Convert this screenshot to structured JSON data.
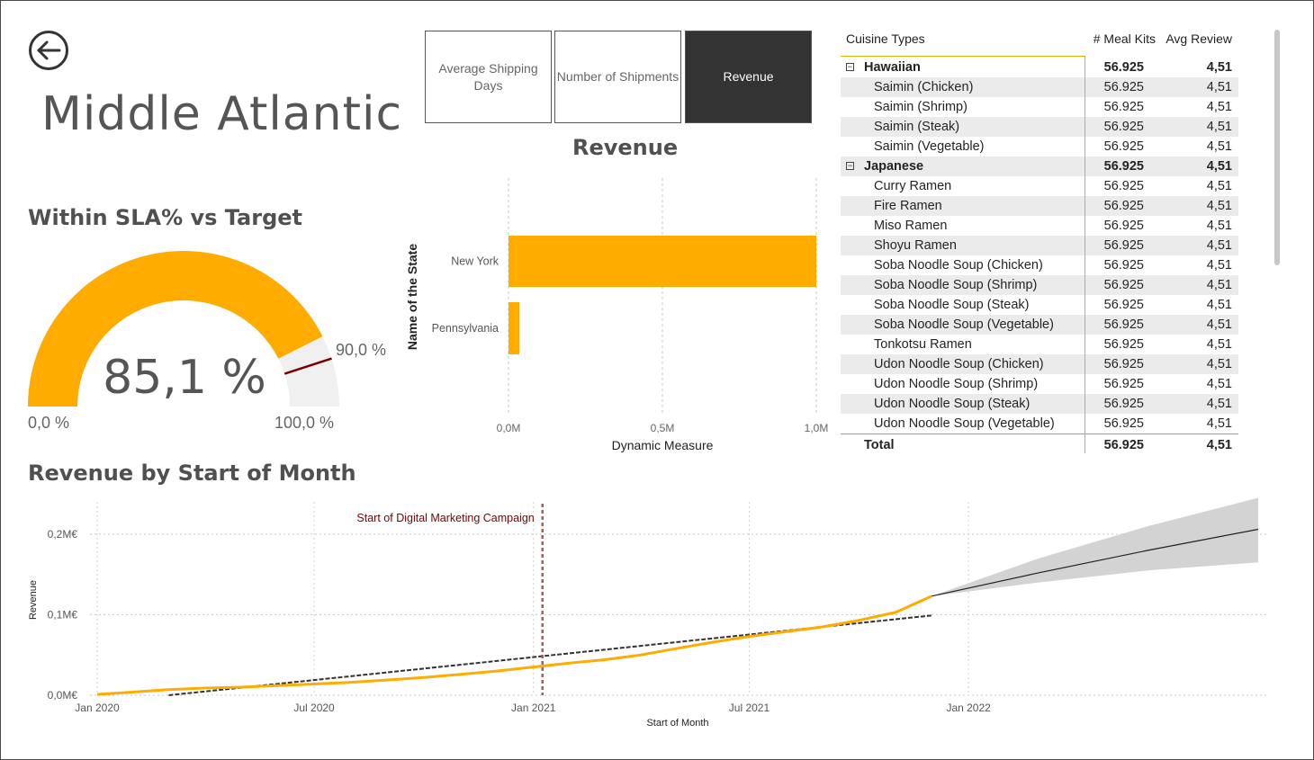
{
  "page": {
    "title": "Middle Atlantic"
  },
  "buttons": [
    {
      "label": "Average Shipping Days",
      "active": false
    },
    {
      "label": "Number of Shipments",
      "active": false
    },
    {
      "label": "Revenue",
      "active": true
    }
  ],
  "gauge": {
    "title": "Within SLA% vs Target",
    "value_label": "85,1 %",
    "min_label": "0,0 %",
    "max_label": "100,0 %",
    "target_label": "90,0 %",
    "value": 85.1,
    "target": 90.0,
    "min": 0,
    "max": 100,
    "fill_color": "#FFAB00",
    "track_color": "#F0F0F0",
    "target_color": "#7A0000"
  },
  "bar_chart": {
    "title": "Revenue",
    "ylabel": "Name of the State",
    "xlabel": "Dynamic Measure",
    "ticks": [
      "0,0M",
      "0,5M",
      "1,0M"
    ]
  },
  "line_chart": {
    "title": "Revenue by Start of Month",
    "ylabel": "Revenue",
    "xlabel": "Start of Month",
    "y_ticks": [
      "0,0M€",
      "0,1M€",
      "0,2M€"
    ],
    "x_ticks": [
      "Jan 2020",
      "Jul 2020",
      "Jan 2021",
      "Jul 2021",
      "Jan 2022"
    ],
    "annotation": "Start of Digital Marketing Campaign"
  },
  "chart_data": [
    {
      "type": "gauge",
      "value": 85.1,
      "target": 90.0,
      "min": 0,
      "max": 100
    },
    {
      "type": "bar",
      "orientation": "horizontal",
      "title": "Revenue",
      "categories": [
        "New York",
        "Pennsylvania"
      ],
      "values": [
        1.0,
        0.035
      ],
      "unit": "M",
      "xlabel": "Dynamic Measure",
      "ylabel": "Name of the State",
      "xlim": [
        0,
        1.0
      ],
      "color": "#FFAB00"
    },
    {
      "type": "line",
      "title": "Revenue by Start of Month",
      "xlabel": "Start of Month",
      "ylabel": "Revenue",
      "ylim": [
        0,
        0.24
      ],
      "unit": "M€",
      "x_range": [
        "2020-01-01",
        "2022-09-01"
      ],
      "series": [
        {
          "color": "#FFAB00",
          "x": [
            "2020-01-01",
            "2020-02-01",
            "2020-03-01",
            "2020-04-01",
            "2020-05-01",
            "2020-06-01",
            "2020-07-01",
            "2020-08-01",
            "2020-09-01",
            "2020-10-01",
            "2020-11-01",
            "2020-12-01",
            "2021-01-01",
            "2021-02-01",
            "2021-03-01",
            "2021-04-01",
            "2021-05-01",
            "2021-06-01",
            "2021-07-01",
            "2021-08-01",
            "2021-09-01",
            "2021-10-01",
            "2021-11-01",
            "2021-12-01"
          ],
          "values": [
            0.001,
            0.004,
            0.007,
            0.009,
            0.01,
            0.012,
            0.014,
            0.016,
            0.019,
            0.022,
            0.026,
            0.03,
            0.035,
            0.04,
            0.044,
            0.05,
            0.058,
            0.066,
            0.073,
            0.079,
            0.085,
            0.093,
            0.103,
            0.123
          ]
        },
        {
          "style": "dashed",
          "color": "#333333",
          "x": [
            "2020-03-01",
            "2021-12-01"
          ],
          "values": [
            0.0,
            0.099
          ]
        },
        {
          "style": "forecast",
          "color": "#222222",
          "band_color": "#D3D3D3",
          "x": [
            "2021-12-01",
            "2022-03-01",
            "2022-06-01",
            "2022-09-01"
          ],
          "values": [
            0.123,
            0.152,
            0.18,
            0.206
          ],
          "upper": [
            0.123,
            0.17,
            0.21,
            0.245
          ],
          "lower": [
            0.123,
            0.14,
            0.155,
            0.165
          ]
        }
      ],
      "annotations": [
        {
          "x": "2021-01-01",
          "label": "Start of Digital Marketing Campaign",
          "color": "#7A0000",
          "style": "dashed"
        }
      ]
    }
  ],
  "table": {
    "columns": [
      "Cuisine Types",
      "# Meal Kits",
      "Avg Review"
    ],
    "groups": [
      {
        "name": "Hawaiian",
        "meal_kits": "56.925",
        "avg_review": "4,51",
        "items": [
          {
            "name": "Saimin (Chicken)",
            "meal_kits": "56.925",
            "avg_review": "4,51"
          },
          {
            "name": "Saimin (Shrimp)",
            "meal_kits": "56.925",
            "avg_review": "4,51"
          },
          {
            "name": "Saimin (Steak)",
            "meal_kits": "56.925",
            "avg_review": "4,51"
          },
          {
            "name": "Saimin (Vegetable)",
            "meal_kits": "56.925",
            "avg_review": "4,51"
          }
        ]
      },
      {
        "name": "Japanese",
        "meal_kits": "56.925",
        "avg_review": "4,51",
        "items": [
          {
            "name": "Curry Ramen",
            "meal_kits": "56.925",
            "avg_review": "4,51"
          },
          {
            "name": "Fire Ramen",
            "meal_kits": "56.925",
            "avg_review": "4,51"
          },
          {
            "name": "Miso Ramen",
            "meal_kits": "56.925",
            "avg_review": "4,51"
          },
          {
            "name": "Shoyu Ramen",
            "meal_kits": "56.925",
            "avg_review": "4,51"
          },
          {
            "name": "Soba Noodle Soup (Chicken)",
            "meal_kits": "56.925",
            "avg_review": "4,51"
          },
          {
            "name": "Soba Noodle Soup (Shrimp)",
            "meal_kits": "56.925",
            "avg_review": "4,51"
          },
          {
            "name": "Soba Noodle Soup (Steak)",
            "meal_kits": "56.925",
            "avg_review": "4,51"
          },
          {
            "name": "Soba Noodle Soup (Vegetable)",
            "meal_kits": "56.925",
            "avg_review": "4,51"
          },
          {
            "name": "Tonkotsu Ramen",
            "meal_kits": "56.925",
            "avg_review": "4,51"
          },
          {
            "name": "Udon Noodle Soup (Chicken)",
            "meal_kits": "56.925",
            "avg_review": "4,51"
          },
          {
            "name": "Udon Noodle Soup (Shrimp)",
            "meal_kits": "56.925",
            "avg_review": "4,51"
          },
          {
            "name": "Udon Noodle Soup (Steak)",
            "meal_kits": "56.925",
            "avg_review": "4,51"
          },
          {
            "name": "Udon Noodle Soup (Vegetable)",
            "meal_kits": "56.925",
            "avg_review": "4,51"
          }
        ]
      }
    ],
    "total": {
      "label": "Total",
      "meal_kits": "56.925",
      "avg_review": "4,51"
    },
    "expand_icon": "minus-box-icon"
  },
  "icons": {
    "back": "back-arrow-icon"
  },
  "colors": {
    "accent": "#FFAB00",
    "dark_button": "#333333",
    "title_gray": "#555555"
  }
}
